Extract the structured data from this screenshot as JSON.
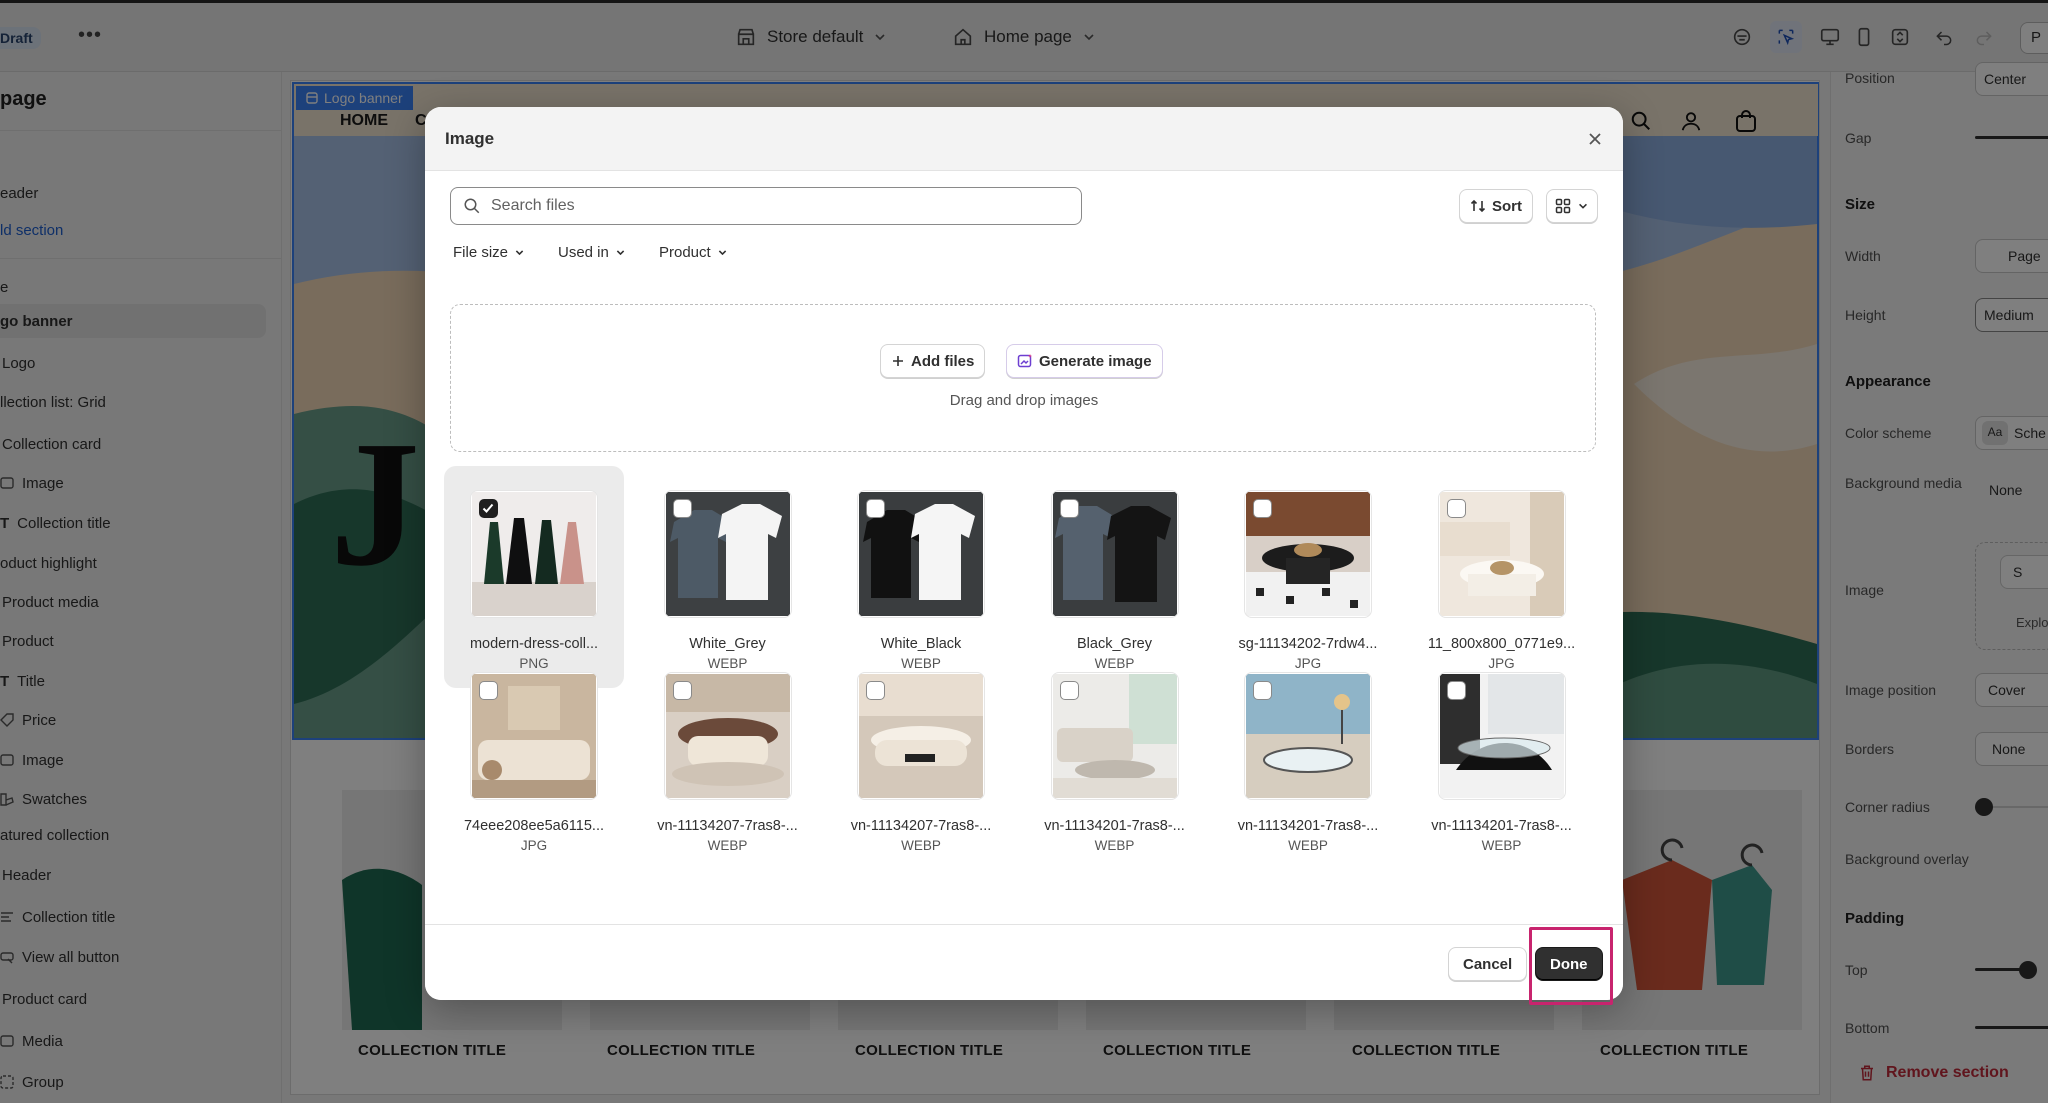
{
  "topbar": {
    "draft_badge": "Draft",
    "more": "•••",
    "store_selector": "Store default",
    "page_selector": "Home page",
    "cut_text": "P"
  },
  "left_sidebar": {
    "title": "page",
    "items": [
      {
        "label": "eader",
        "kind": "plain"
      },
      {
        "label": "ld section",
        "kind": "link"
      },
      {
        "label": "e",
        "kind": "plain"
      },
      {
        "label": "go banner",
        "kind": "selected"
      },
      {
        "label": "Logo",
        "kind": "child"
      },
      {
        "label": "llection list: Grid",
        "kind": "plain"
      },
      {
        "label": "Collection card",
        "kind": "child"
      },
      {
        "label": "Image",
        "kind": "grandchild"
      },
      {
        "label": "Collection title",
        "kind": "grandchild"
      },
      {
        "label": "oduct highlight",
        "kind": "plain"
      },
      {
        "label": "Product media",
        "kind": "child"
      },
      {
        "label": "Product",
        "kind": "child"
      },
      {
        "label": "Title",
        "kind": "grandchild"
      },
      {
        "label": "Price",
        "kind": "grandchild"
      },
      {
        "label": "Image",
        "kind": "grandchild"
      },
      {
        "label": "Swatches",
        "kind": "grandchild"
      },
      {
        "label": "atured collection",
        "kind": "plain"
      },
      {
        "label": "Header",
        "kind": "child"
      },
      {
        "label": "Collection title",
        "kind": "grandchild"
      },
      {
        "label": "View all button",
        "kind": "grandchild"
      },
      {
        "label": "Product card",
        "kind": "child"
      },
      {
        "label": "Media",
        "kind": "grandchild"
      },
      {
        "label": "Group",
        "kind": "grandchild"
      }
    ]
  },
  "canvas": {
    "banner_tag": "Logo banner",
    "nav_home": "HOME",
    "nav_cut": "C",
    "hero_letter": "J",
    "collection_titles": [
      "COLLECTION TITLE",
      "COLLECTION TITLE",
      "COLLECTION TITLE",
      "COLLECTION TITLE",
      "COLLECTION TITLE",
      "COLLECTION TITLE"
    ]
  },
  "right_sidebar": {
    "position_label": "Position",
    "position_value": "Center",
    "gap_label": "Gap",
    "size_heading": "Size",
    "width_label": "Width",
    "width_value": "Page",
    "height_label": "Height",
    "height_value": "Medium",
    "appearance_heading": "Appearance",
    "color_scheme_label": "Color scheme",
    "color_scheme_value": "Sche",
    "color_scheme_swatch": "Aa",
    "bg_media_label": "Background media",
    "bg_media_value": "None",
    "image_label": "Image",
    "image_btn_cut": "S",
    "image_explore_cut": "Explo",
    "image_position_label": "Image position",
    "image_position_value": "Cover",
    "borders_label": "Borders",
    "borders_value": "None",
    "corner_radius_label": "Corner radius",
    "bg_overlay_label": "Background overlay",
    "padding_heading": "Padding",
    "top_label": "Top",
    "bottom_label": "Bottom",
    "remove_section": "Remove section"
  },
  "modal": {
    "title": "Image",
    "search_placeholder": "Search files",
    "sort_label": "Sort",
    "filters": [
      "File size",
      "Used in",
      "Product"
    ],
    "add_files": "Add files",
    "generate_image": "Generate image",
    "drag_drop": "Drag and drop images",
    "files": [
      {
        "name": "modern-dress-coll...",
        "type": "PNG",
        "selected": true,
        "art": "dress"
      },
      {
        "name": "White_Grey",
        "type": "WEBP",
        "selected": false,
        "art": "shirts-wg"
      },
      {
        "name": "White_Black",
        "type": "WEBP",
        "selected": false,
        "art": "shirts-wb"
      },
      {
        "name": "Black_Grey",
        "type": "WEBP",
        "selected": false,
        "art": "shirts-bg"
      },
      {
        "name": "sg-11134202-7rdw4...",
        "type": "JPG",
        "selected": false,
        "art": "table-dark"
      },
      {
        "name": "11_800x800_0771e9...",
        "type": "JPG",
        "selected": false,
        "art": "table-white"
      },
      {
        "name": "74eee208ee5a6115...",
        "type": "JPG",
        "selected": false,
        "art": "sofa-beige"
      },
      {
        "name": "vn-11134207-7ras8-...",
        "type": "WEBP",
        "selected": false,
        "art": "table-cream"
      },
      {
        "name": "vn-11134207-7ras8-...",
        "type": "WEBP",
        "selected": false,
        "art": "table-oval"
      },
      {
        "name": "vn-11134201-7ras8-...",
        "type": "WEBP",
        "selected": false,
        "art": "living-bright"
      },
      {
        "name": "vn-11134201-7ras8-...",
        "type": "WEBP",
        "selected": false,
        "art": "living-window"
      },
      {
        "name": "vn-11134201-7ras8-...",
        "type": "WEBP",
        "selected": false,
        "art": "table-black"
      }
    ],
    "cancel": "Cancel",
    "done": "Done"
  },
  "colors": {
    "accent_blue": "#3b82f6",
    "highlight_magenta": "#c8246e",
    "done_button": "#303030",
    "remove_red": "#c12b3a"
  }
}
